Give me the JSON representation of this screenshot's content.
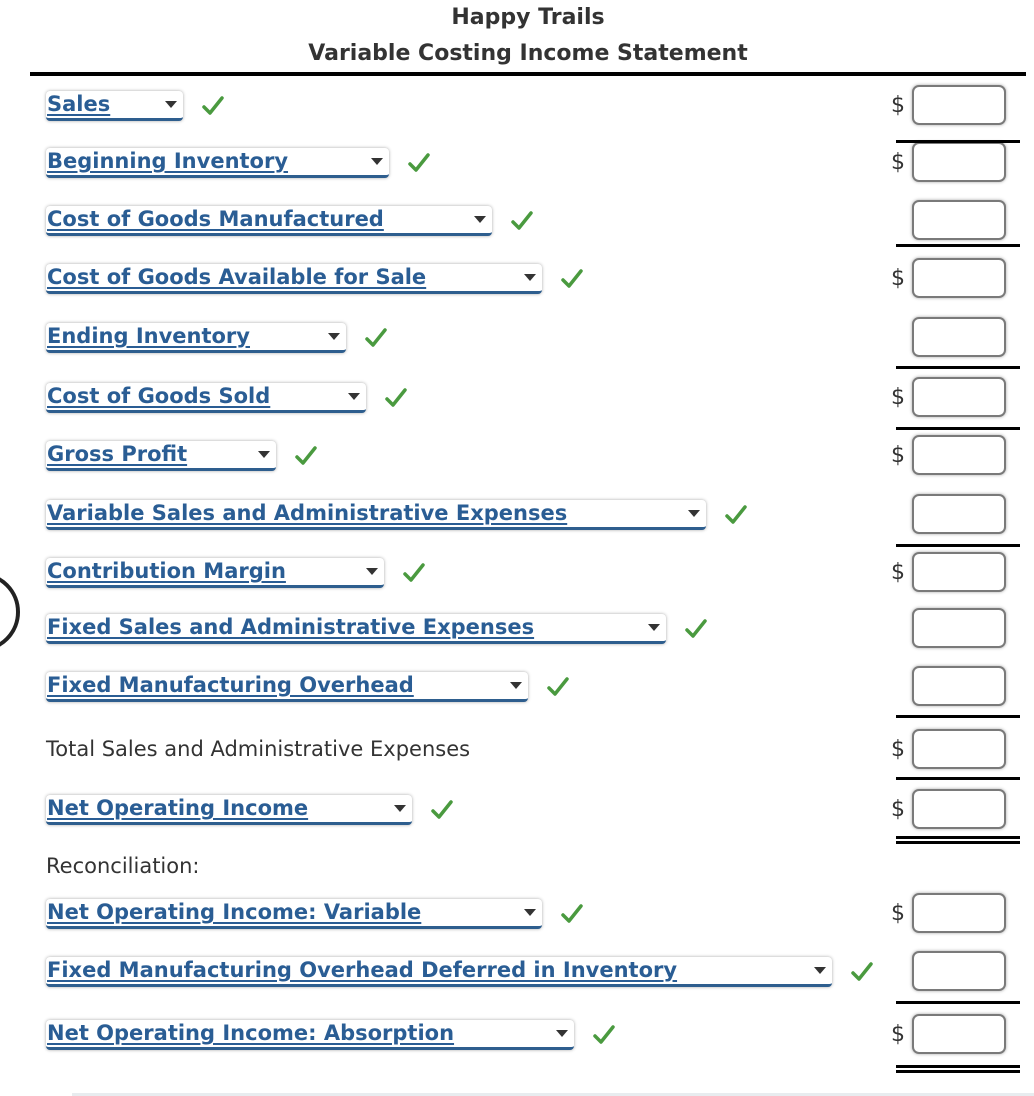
{
  "header": {
    "company": "Happy Trails",
    "statement_title": "Variable Costing Income Statement"
  },
  "currency_symbol": "$",
  "colors": {
    "select_text": "#2a5d94",
    "select_underline": "#2e5e8e",
    "check": "#4a9a3f",
    "text": "#333333"
  },
  "rows": [
    {
      "type": "select",
      "label": "Sales",
      "correct": true,
      "dollar": true,
      "value": ""
    },
    {
      "type": "select",
      "label": "Beginning Inventory",
      "correct": true,
      "dollar": true,
      "value": ""
    },
    {
      "type": "select",
      "label": "Cost of Goods Manufactured",
      "correct": true,
      "dollar": false,
      "value": ""
    },
    {
      "type": "select",
      "label": "Cost of Goods Available for Sale",
      "correct": true,
      "dollar": true,
      "value": ""
    },
    {
      "type": "select",
      "label": "Ending Inventory",
      "correct": true,
      "dollar": false,
      "value": ""
    },
    {
      "type": "select",
      "label": "Cost of Goods Sold",
      "correct": true,
      "dollar": true,
      "value": ""
    },
    {
      "type": "select",
      "label": "Gross Profit",
      "correct": true,
      "dollar": true,
      "value": ""
    },
    {
      "type": "select",
      "label": "Variable Sales and Administrative Expenses",
      "correct": true,
      "dollar": false,
      "value": ""
    },
    {
      "type": "select",
      "label": "Contribution Margin",
      "correct": true,
      "dollar": true,
      "value": ""
    },
    {
      "type": "select",
      "label": "Fixed Sales and Administrative Expenses",
      "correct": true,
      "dollar": false,
      "value": ""
    },
    {
      "type": "select",
      "label": "Fixed Manufacturing Overhead",
      "correct": true,
      "dollar": false,
      "value": ""
    },
    {
      "type": "text",
      "label": "Total Sales and Administrative Expenses",
      "dollar": true,
      "value": ""
    },
    {
      "type": "select",
      "label": "Net Operating Income",
      "correct": true,
      "dollar": true,
      "value": ""
    },
    {
      "type": "heading",
      "label": "Reconciliation:"
    },
    {
      "type": "select",
      "label": "Net Operating Income: Variable",
      "correct": true,
      "dollar": true,
      "value": ""
    },
    {
      "type": "select",
      "label": "Fixed Manufacturing Overhead Deferred in Inventory",
      "correct": true,
      "dollar": false,
      "value": ""
    },
    {
      "type": "select",
      "label": "Net Operating Income: Absorption",
      "correct": true,
      "dollar": true,
      "value": ""
    }
  ]
}
